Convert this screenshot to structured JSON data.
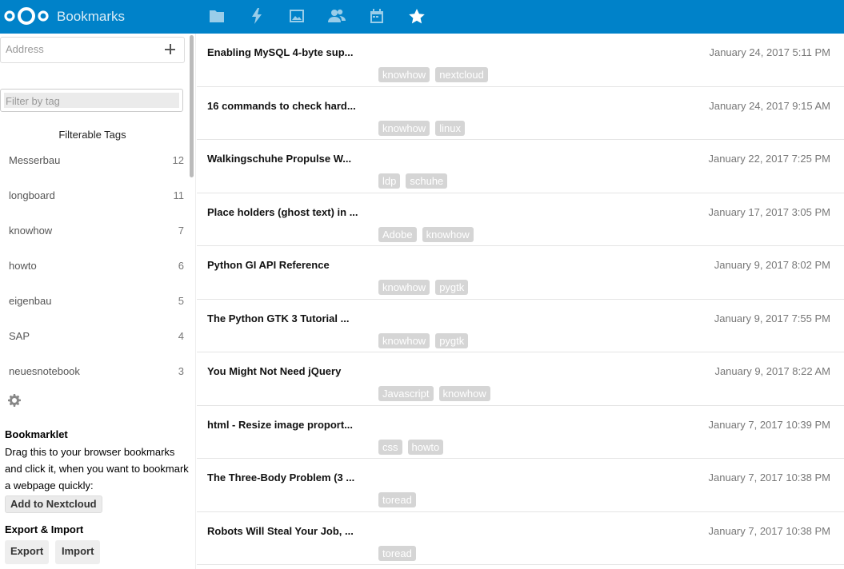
{
  "header": {
    "title": "Bookmarks",
    "accent_color": "#0082c9",
    "app_icons": [
      {
        "name": "folder-icon",
        "label": "Files"
      },
      {
        "name": "activity-icon",
        "label": "Activity"
      },
      {
        "name": "image-icon",
        "label": "Gallery"
      },
      {
        "name": "contacts-icon",
        "label": "Contacts"
      },
      {
        "name": "calendar-icon",
        "label": "Calendar"
      },
      {
        "name": "star-icon",
        "label": "Bookmarks"
      }
    ]
  },
  "sidebar": {
    "address_placeholder": "Address",
    "filter_placeholder": "Filter by tag",
    "tags_title": "Filterable Tags",
    "tags": [
      {
        "name": "Messerbau",
        "count": "12"
      },
      {
        "name": "longboard",
        "count": "11"
      },
      {
        "name": "knowhow",
        "count": "7"
      },
      {
        "name": "howto",
        "count": "6"
      },
      {
        "name": "eigenbau",
        "count": "5"
      },
      {
        "name": "SAP",
        "count": "4"
      },
      {
        "name": "neuesnotebook",
        "count": "3"
      }
    ],
    "bookmarklet": {
      "title": "Bookmarklet",
      "text": "Drag this to your browser bookmarks and click it, when you want to bookmark a webpage quickly:",
      "button": "Add to Nextcloud"
    },
    "export_import": {
      "title": "Export & Import",
      "export_label": "Export",
      "import_label": "Import"
    }
  },
  "bookmarks": [
    {
      "title": "Enabling MySQL 4-byte sup...",
      "date": "January 24, 2017 5:11 PM",
      "tags": [
        "knowhow",
        "nextcloud"
      ]
    },
    {
      "title": "16 commands to check hard...",
      "date": "January 24, 2017 9:15 AM",
      "tags": [
        "knowhow",
        "linux"
      ]
    },
    {
      "title": "Walkingschuhe Propulse W...",
      "date": "January 22, 2017 7:25 PM",
      "tags": [
        "ldp",
        "schuhe"
      ]
    },
    {
      "title": "Place holders (ghost text) in ...",
      "date": "January 17, 2017 3:05 PM",
      "tags": [
        "Adobe",
        "knowhow"
      ]
    },
    {
      "title": "Python GI API Reference",
      "date": "January 9, 2017 8:02 PM",
      "tags": [
        "knowhow",
        "pygtk"
      ]
    },
    {
      "title": "The Python GTK 3 Tutorial ...",
      "date": "January 9, 2017 7:55 PM",
      "tags": [
        "knowhow",
        "pygtk"
      ]
    },
    {
      "title": "You Might Not Need jQuery",
      "date": "January 9, 2017 8:22 AM",
      "tags": [
        "Javascript",
        "knowhow"
      ]
    },
    {
      "title": "html - Resize image proport...",
      "date": "January 7, 2017 10:39 PM",
      "tags": [
        "css",
        "howto"
      ]
    },
    {
      "title": "The Three-Body Problem (3 ...",
      "date": "January 7, 2017 10:38 PM",
      "tags": [
        "toread"
      ]
    },
    {
      "title": "Robots Will Steal Your Job, ...",
      "date": "January 7, 2017 10:38 PM",
      "tags": [
        "toread"
      ]
    }
  ]
}
